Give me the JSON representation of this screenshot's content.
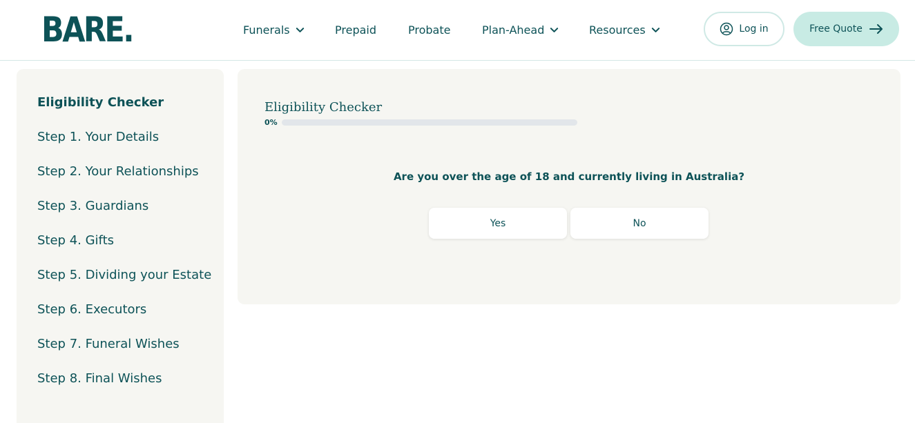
{
  "brand": {
    "logo_text": "BARE."
  },
  "nav": {
    "items": [
      {
        "label": "Funerals",
        "has_dropdown": true
      },
      {
        "label": "Prepaid",
        "has_dropdown": false
      },
      {
        "label": "Probate",
        "has_dropdown": false
      },
      {
        "label": "Plan-Ahead",
        "has_dropdown": true
      },
      {
        "label": "Resources",
        "has_dropdown": true
      }
    ],
    "login_label": "Log in",
    "quote_label": "Free Quote"
  },
  "sidebar": {
    "title": "Eligibility Checker",
    "steps": [
      "Step 1. Your Details",
      "Step 2. Your Relationships",
      "Step 3. Guardians",
      "Step 4. Gifts",
      "Step 5. Dividing your Estate",
      "Step 6. Executors",
      "Step 7. Funeral Wishes",
      "Step 8. Final Wishes"
    ]
  },
  "main": {
    "title": "Eligibility Checker",
    "progress_label": "0%",
    "progress_value": 0,
    "question": "Are you over the age of 18 and currently living in Australia?",
    "answers": {
      "yes": "Yes",
      "no": "No"
    }
  },
  "colors": {
    "primary": "#0d5257",
    "panel_bg": "#f6f6f2",
    "accent_button": "#c8ebe4",
    "progress_track": "#e2e6ea"
  }
}
